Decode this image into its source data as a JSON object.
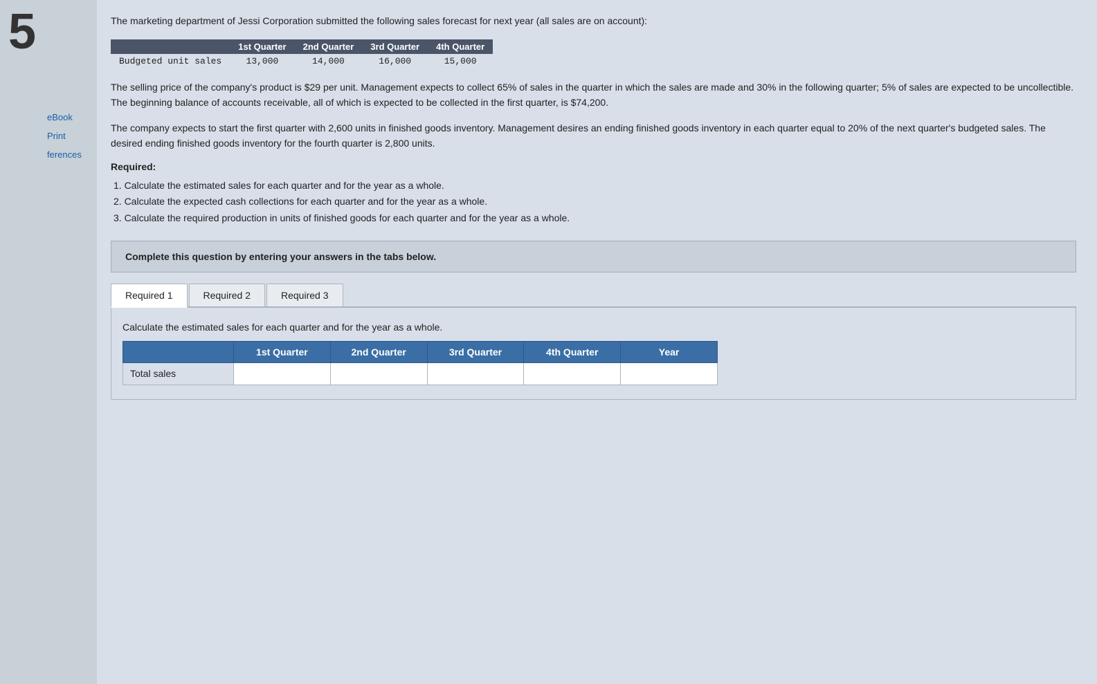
{
  "page_number": "5",
  "sidebar": {
    "items": [
      {
        "label": "eBook"
      },
      {
        "label": "Print"
      },
      {
        "label": "ferences"
      }
    ]
  },
  "problem": {
    "intro": "The marketing department of Jessi Corporation submitted the following sales forecast for next year (all sales are on account):",
    "forecast_table": {
      "headers": [
        "",
        "1st Quarter",
        "2nd Quarter",
        "3rd Quarter",
        "4th Quarter"
      ],
      "row": {
        "label": "Budgeted unit sales",
        "values": [
          "13,000",
          "14,000",
          "16,000",
          "15,000"
        ]
      }
    },
    "paragraph1": "The selling price of the company's product is $29 per unit. Management expects to collect 65% of sales in the quarter in which the sales are made and 30% in the following quarter; 5% of sales are expected to be uncollectible. The beginning balance of accounts receivable, all of which is expected to be collected in the first quarter, is $74,200.",
    "paragraph2": "The company expects to start the first quarter with 2,600 units in finished goods inventory. Management desires an ending finished goods inventory in each quarter equal to 20% of the next quarter's budgeted sales. The desired ending finished goods inventory for the fourth quarter is 2,800 units.",
    "required_label": "Required:",
    "required_items": [
      "1. Calculate the estimated sales for each quarter and for the year as a whole.",
      "2. Calculate the expected cash collections for each quarter and for the year as a whole.",
      "3. Calculate the required production in units of finished goods for each quarter and for the year as a whole."
    ],
    "complete_instruction": "Complete this question by entering your answers in the tabs below.",
    "tabs": [
      {
        "label": "Required 1",
        "active": true
      },
      {
        "label": "Required 2",
        "active": false
      },
      {
        "label": "Required 3",
        "active": false
      }
    ],
    "tab_description": "Calculate the estimated sales for each quarter and for the year as a whole.",
    "answer_table": {
      "headers": [
        "",
        "1st Quarter",
        "2nd Quarter",
        "3rd Quarter",
        "4th Quarter",
        "Year"
      ],
      "row_label": "Total sales"
    }
  }
}
